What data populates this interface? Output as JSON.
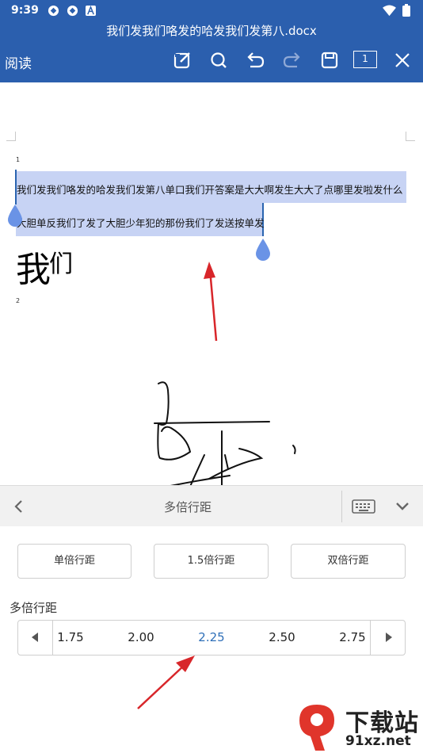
{
  "status_bar": {
    "time": "9:39",
    "battery_icon": "battery-icon",
    "wifi_icon": "wifi-icon"
  },
  "header": {
    "doc_title": "我们发我们咯发的哈发我们发第八.docx",
    "mode_label": "阅读",
    "page_indicator": "1",
    "bg_color": "#2b5fae"
  },
  "document": {
    "page1_number": "1",
    "page2_number": "2",
    "line1": "我们发我们咯发的哈发我们发第八单口我们开答案是大大啊发生大大了点哪里发啦发什么",
    "line2": "大胆单反我们了发了大胆少年犯的那份我们了发送按单发",
    "big_text_1": "我",
    "big_text_2": "们",
    "selection_color": "#c7d3f4",
    "handle_color": "#6a93e6"
  },
  "panel": {
    "title": "多倍行距",
    "spacing_buttons": [
      "单倍行距",
      "1.5倍行距",
      "双倍行距"
    ],
    "multi_label": "多倍行距",
    "picker_values": [
      "1.75",
      "2.00",
      "2.25",
      "2.50",
      "2.75"
    ],
    "picker_selected": "2.25",
    "selected_color": "#2e6fb8"
  },
  "watermark": {
    "main": "下载站",
    "site": "91xz.net"
  }
}
